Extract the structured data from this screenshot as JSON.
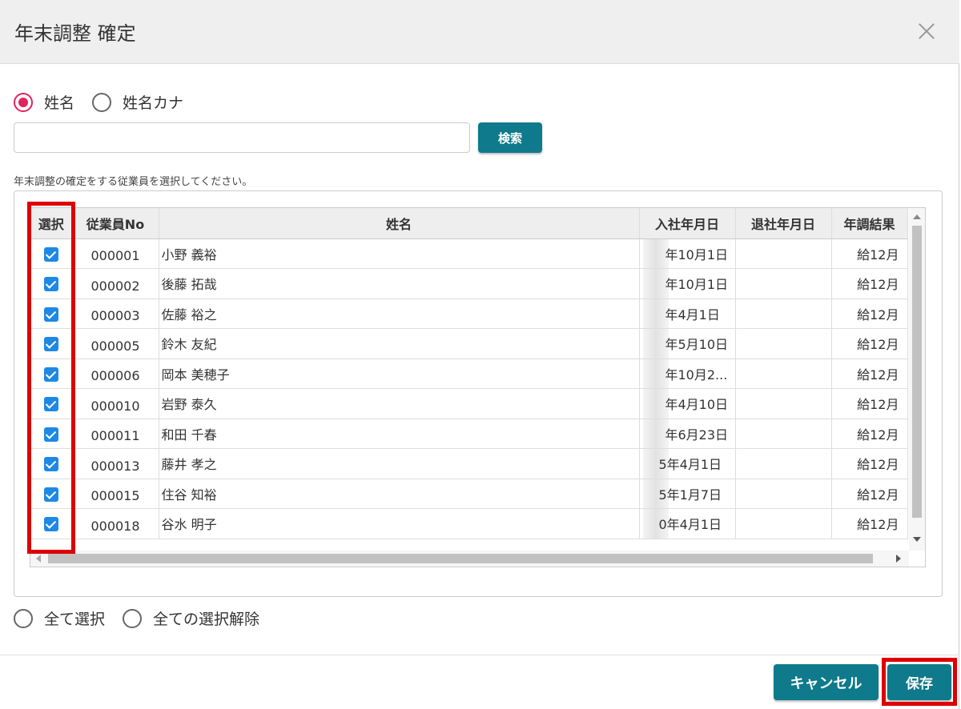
{
  "dialog": {
    "title": "年末調整 確定",
    "close_icon": "close-icon"
  },
  "search_mode": {
    "options": [
      "姓名",
      "姓名カナ"
    ],
    "selected": "姓名"
  },
  "search": {
    "value": "",
    "placeholder": "",
    "button_label": "検索"
  },
  "instruction": "年末調整の確定をする従業員を選択してください。",
  "table": {
    "columns": [
      "選択",
      "従業員No",
      "姓名",
      "入社年月日",
      "退社年月日",
      "年調結果"
    ],
    "rows": [
      {
        "selected": true,
        "no": "000001",
        "name": "小野 義裕",
        "hire_date": "年10月1日",
        "leave_date": "",
        "result": "給12月"
      },
      {
        "selected": true,
        "no": "000002",
        "name": "後藤 拓哉",
        "hire_date": "年10月1日",
        "leave_date": "",
        "result": "給12月"
      },
      {
        "selected": true,
        "no": "000003",
        "name": "佐藤 裕之",
        "hire_date": "年4月1日",
        "leave_date": "",
        "result": "給12月"
      },
      {
        "selected": true,
        "no": "000005",
        "name": "鈴木 友紀",
        "hire_date": "年5月10日",
        "leave_date": "",
        "result": "給12月"
      },
      {
        "selected": true,
        "no": "000006",
        "name": "岡本 美穂子",
        "hire_date": "年10月2...",
        "leave_date": "",
        "result": "給12月"
      },
      {
        "selected": true,
        "no": "000010",
        "name": "岩野 泰久",
        "hire_date": "年4月10日",
        "leave_date": "",
        "result": "給12月"
      },
      {
        "selected": true,
        "no": "000011",
        "name": "和田 千春",
        "hire_date": "年6月23日",
        "leave_date": "",
        "result": "給12月"
      },
      {
        "selected": true,
        "no": "000013",
        "name": "藤井 孝之",
        "hire_date": "5年4月1日",
        "leave_date": "",
        "result": "給12月"
      },
      {
        "selected": true,
        "no": "000015",
        "name": "住谷 知裕",
        "hire_date": "5年1月7日",
        "leave_date": "",
        "result": "給12月"
      },
      {
        "selected": true,
        "no": "000018",
        "name": "谷水 明子",
        "hire_date": "0年4月1日",
        "leave_date": "",
        "result": "給12月"
      }
    ]
  },
  "bulk": {
    "options": [
      "全て選択",
      "全ての選択解除"
    ]
  },
  "footer": {
    "cancel_label": "キャンセル",
    "save_label": "保存"
  },
  "colors": {
    "accent": "#0e7a8c",
    "radio_selected": "#e0245e",
    "checkbox": "#1e88e5",
    "highlight": "#dd0000"
  }
}
